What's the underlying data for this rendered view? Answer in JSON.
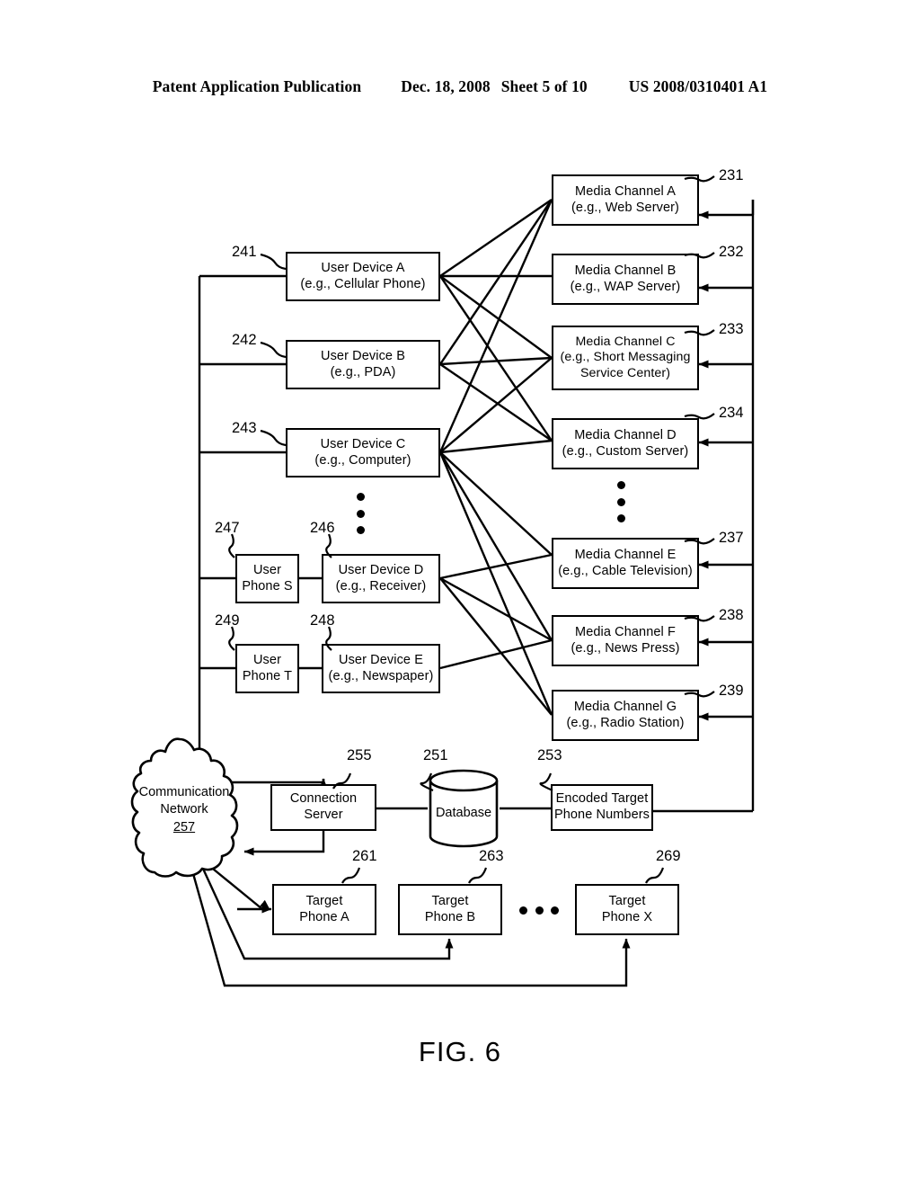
{
  "header": {
    "publication": "Patent Application Publication",
    "date": "Dec. 18, 2008",
    "sheet": "Sheet 5 of 10",
    "patent_number": "US 2008/0310401 A1"
  },
  "figure": {
    "caption": "FIG. 6"
  },
  "media_channels": [
    {
      "ref": "231",
      "line1": "Media Channel  A",
      "line2": "(e.g., Web Server)"
    },
    {
      "ref": "232",
      "line1": "Media Channel  B",
      "line2": "(e.g., WAP Server)"
    },
    {
      "ref": "233",
      "line1": "Media Channel  C",
      "line2": "(e.g., Short Messaging",
      "line3": "Service Center)"
    },
    {
      "ref": "234",
      "line1": "Media Channel  D",
      "line2": "(e.g., Custom Server)"
    },
    {
      "ref": "237",
      "line1": "Media Channel  E",
      "line2": "(e.g., Cable Television)"
    },
    {
      "ref": "238",
      "line1": "Media Channel  F",
      "line2": "(e.g., News Press)"
    },
    {
      "ref": "239",
      "line1": "Media Channel  G",
      "line2": "(e.g., Radio Station)"
    }
  ],
  "user_devices": [
    {
      "ref": "241",
      "line1": "User Device  A",
      "line2": "(e.g., Cellular Phone)"
    },
    {
      "ref": "242",
      "line1": "User Device  B",
      "line2": "(e.g., PDA)"
    },
    {
      "ref": "243",
      "line1": "User Device  C",
      "line2": "(e.g., Computer)"
    },
    {
      "ref": "246",
      "line1": "User Device  D",
      "line2": "(e.g., Receiver)"
    },
    {
      "ref": "248",
      "line1": "User Device  E",
      "line2": "(e.g., Newspaper)"
    }
  ],
  "user_phones": [
    {
      "ref": "247",
      "line1": "User",
      "line2": "Phone S"
    },
    {
      "ref": "249",
      "line1": "User",
      "line2": "Phone T"
    }
  ],
  "infrastructure": {
    "cloud": {
      "line1": "Communication",
      "line2": "Network",
      "ref": "257"
    },
    "connection_server": {
      "ref": "255",
      "line1": "Connection",
      "line2": "Server"
    },
    "database": {
      "ref": "251",
      "label": "Database"
    },
    "encoded_numbers": {
      "ref": "253",
      "line1": "Encoded Target",
      "line2": "Phone Numbers"
    }
  },
  "target_phones": [
    {
      "ref": "261",
      "line1": "Target",
      "line2": "Phone A"
    },
    {
      "ref": "263",
      "line1": "Target",
      "line2": "Phone B"
    },
    {
      "ref": "269",
      "line1": "Target",
      "line2": "Phone X"
    }
  ]
}
